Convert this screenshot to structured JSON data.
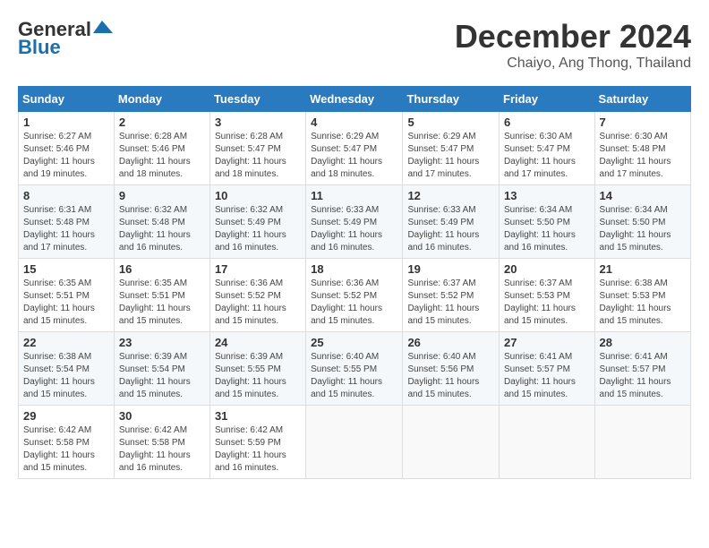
{
  "header": {
    "logo_general": "General",
    "logo_blue": "Blue",
    "month_title": "December 2024",
    "location": "Chaiyo, Ang Thong, Thailand"
  },
  "days_of_week": [
    "Sunday",
    "Monday",
    "Tuesday",
    "Wednesday",
    "Thursday",
    "Friday",
    "Saturday"
  ],
  "weeks": [
    [
      {
        "day": "1",
        "sunrise": "6:27 AM",
        "sunset": "5:46 PM",
        "daylight": "11 hours and 19 minutes."
      },
      {
        "day": "2",
        "sunrise": "6:28 AM",
        "sunset": "5:46 PM",
        "daylight": "11 hours and 18 minutes."
      },
      {
        "day": "3",
        "sunrise": "6:28 AM",
        "sunset": "5:47 PM",
        "daylight": "11 hours and 18 minutes."
      },
      {
        "day": "4",
        "sunrise": "6:29 AM",
        "sunset": "5:47 PM",
        "daylight": "11 hours and 18 minutes."
      },
      {
        "day": "5",
        "sunrise": "6:29 AM",
        "sunset": "5:47 PM",
        "daylight": "11 hours and 17 minutes."
      },
      {
        "day": "6",
        "sunrise": "6:30 AM",
        "sunset": "5:47 PM",
        "daylight": "11 hours and 17 minutes."
      },
      {
        "day": "7",
        "sunrise": "6:30 AM",
        "sunset": "5:48 PM",
        "daylight": "11 hours and 17 minutes."
      }
    ],
    [
      {
        "day": "8",
        "sunrise": "6:31 AM",
        "sunset": "5:48 PM",
        "daylight": "11 hours and 17 minutes."
      },
      {
        "day": "9",
        "sunrise": "6:32 AM",
        "sunset": "5:48 PM",
        "daylight": "11 hours and 16 minutes."
      },
      {
        "day": "10",
        "sunrise": "6:32 AM",
        "sunset": "5:49 PM",
        "daylight": "11 hours and 16 minutes."
      },
      {
        "day": "11",
        "sunrise": "6:33 AM",
        "sunset": "5:49 PM",
        "daylight": "11 hours and 16 minutes."
      },
      {
        "day": "12",
        "sunrise": "6:33 AM",
        "sunset": "5:49 PM",
        "daylight": "11 hours and 16 minutes."
      },
      {
        "day": "13",
        "sunrise": "6:34 AM",
        "sunset": "5:50 PM",
        "daylight": "11 hours and 16 minutes."
      },
      {
        "day": "14",
        "sunrise": "6:34 AM",
        "sunset": "5:50 PM",
        "daylight": "11 hours and 15 minutes."
      }
    ],
    [
      {
        "day": "15",
        "sunrise": "6:35 AM",
        "sunset": "5:51 PM",
        "daylight": "11 hours and 15 minutes."
      },
      {
        "day": "16",
        "sunrise": "6:35 AM",
        "sunset": "5:51 PM",
        "daylight": "11 hours and 15 minutes."
      },
      {
        "day": "17",
        "sunrise": "6:36 AM",
        "sunset": "5:52 PM",
        "daylight": "11 hours and 15 minutes."
      },
      {
        "day": "18",
        "sunrise": "6:36 AM",
        "sunset": "5:52 PM",
        "daylight": "11 hours and 15 minutes."
      },
      {
        "day": "19",
        "sunrise": "6:37 AM",
        "sunset": "5:52 PM",
        "daylight": "11 hours and 15 minutes."
      },
      {
        "day": "20",
        "sunrise": "6:37 AM",
        "sunset": "5:53 PM",
        "daylight": "11 hours and 15 minutes."
      },
      {
        "day": "21",
        "sunrise": "6:38 AM",
        "sunset": "5:53 PM",
        "daylight": "11 hours and 15 minutes."
      }
    ],
    [
      {
        "day": "22",
        "sunrise": "6:38 AM",
        "sunset": "5:54 PM",
        "daylight": "11 hours and 15 minutes."
      },
      {
        "day": "23",
        "sunrise": "6:39 AM",
        "sunset": "5:54 PM",
        "daylight": "11 hours and 15 minutes."
      },
      {
        "day": "24",
        "sunrise": "6:39 AM",
        "sunset": "5:55 PM",
        "daylight": "11 hours and 15 minutes."
      },
      {
        "day": "25",
        "sunrise": "6:40 AM",
        "sunset": "5:55 PM",
        "daylight": "11 hours and 15 minutes."
      },
      {
        "day": "26",
        "sunrise": "6:40 AM",
        "sunset": "5:56 PM",
        "daylight": "11 hours and 15 minutes."
      },
      {
        "day": "27",
        "sunrise": "6:41 AM",
        "sunset": "5:57 PM",
        "daylight": "11 hours and 15 minutes."
      },
      {
        "day": "28",
        "sunrise": "6:41 AM",
        "sunset": "5:57 PM",
        "daylight": "11 hours and 15 minutes."
      }
    ],
    [
      {
        "day": "29",
        "sunrise": "6:42 AM",
        "sunset": "5:58 PM",
        "daylight": "11 hours and 15 minutes."
      },
      {
        "day": "30",
        "sunrise": "6:42 AM",
        "sunset": "5:58 PM",
        "daylight": "11 hours and 16 minutes."
      },
      {
        "day": "31",
        "sunrise": "6:42 AM",
        "sunset": "5:59 PM",
        "daylight": "11 hours and 16 minutes."
      },
      null,
      null,
      null,
      null
    ]
  ]
}
